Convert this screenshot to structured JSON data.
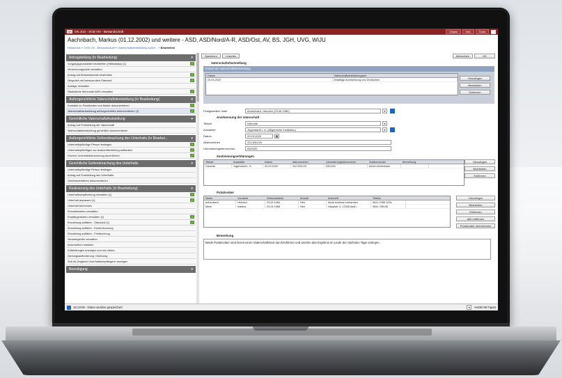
{
  "window": {
    "logo": "OK",
    "title": "OK.JUS - SGB VIII - Bestandschaft",
    "buttons": [
      "Objekt",
      "Info",
      "Tools"
    ]
  },
  "header": {
    "title": "Aachnbach, Markus (01.12.2002) und weitere - ASD, ASD/Nord/A-R, ASD/Ost, AV, BS, JGH, UVG, WIJU",
    "breadcrumb": [
      "Hellamaus",
      "SGB VIII - Bestandschaft",
      "Vaterschaftsfeststellung außer..."
    ],
    "breadcrumb_current": "Bearbeiten"
  },
  "left": {
    "sections": [
      {
        "title": "Antragstellung (In Bearbeitung)",
        "items": [
          {
            "label": "Vorgangsgrunddaten bearbeiten (Hilfeanlass) (1)",
            "check": true
          },
          {
            "label": "Verrechnungsziele verwalten",
            "check": false
          },
          {
            "label": "Antrag auf Beistandschaft bearbeiten",
            "check": true
          },
          {
            "label": "Gespräch mit betreuendem Elternteil",
            "check": true
          },
          {
            "label": "Anträge verwalten",
            "check": false
          },
          {
            "label": "Statistische Merkmale AiBS verwalten",
            "check": true
          }
        ]
      },
      {
        "title": "Außergerichtliche Vaterschaftsfeststellung (In Bearbeitung)",
        "items": [
          {
            "label": "Kontakte zu Putativvater und Mutter dokumentieren",
            "check": true
          },
          {
            "label": "Vaterschaftsfeststellung außergerichtlich dokumentieren (1)",
            "check": true,
            "selected": true
          }
        ]
      },
      {
        "title": "Gerichtliche Vaterschaftsfeststellung",
        "items": [
          {
            "label": "Antrag auf Feststellung der Vaterschaft",
            "check": false
          },
          {
            "label": "Vaterschaftsfeststellung gerichtlich dokumentieren",
            "check": false
          }
        ]
      },
      {
        "title": "Außergerichtliche Geltendmachung des Unterhalts (In Bearbei...",
        "items": [
          {
            "label": "Unterhaltspflichtige Person festlegen",
            "check": true
          },
          {
            "label": "Unterhaltspflichtigen zur Auskunftserteilung auffordern",
            "check": true
          },
          {
            "label": "Externe Unterhaltsberechnung durchführen",
            "check": true
          }
        ]
      },
      {
        "title": "Gerichtliche Geltendmachung des Unterhalts",
        "items": [
          {
            "label": "Unterhaltspflichtige Person festlegen",
            "check": false
          },
          {
            "label": "Antrag auf Feststellung des Unterhalts",
            "check": false
          },
          {
            "label": "Gerichtsverfahren dokumentieren",
            "check": false
          }
        ]
      },
      {
        "title": "Realisierung des Unterhalts (In Bearbeitung)",
        "items": [
          {
            "label": "Unterhaltsverpflichtung verwalten (1)",
            "check": true
          },
          {
            "label": "Unterhalt anpassen (1)",
            "check": true
          },
          {
            "label": "Unterhalt berechnen",
            "check": false
          },
          {
            "label": "Einzahlerdaten verwalten",
            "check": false
          },
          {
            "label": "Empfängerdaten verwalten (1)",
            "check": true
          },
          {
            "label": "Einzahlung auflisten - Standard (1)",
            "check": true
          },
          {
            "label": "Einzahlung auflisten - Kontenbuchung",
            "check": false
          },
          {
            "label": "Einzahlung auflisten - Fristbuchung",
            "check": false
          },
          {
            "label": "Verwahrgelder verwalten",
            "check": false
          },
          {
            "label": "Anschreiben erstellen",
            "check": false
          },
          {
            "label": "Sollstellungen anzeigen und neu bilden",
            "check": false
          },
          {
            "label": "Zahlungsaufforderung / Mahnung",
            "check": false
          },
          {
            "label": "Soll-Ist-Vergleich Unterhaltsempfängerin anzeigen",
            "check": false
          }
        ]
      },
      {
        "title": "Beendigung",
        "items": []
      }
    ]
  },
  "right": {
    "top_buttons": [
      "Speichern",
      "Löschen"
    ],
    "right_buttons": [
      "Abbrechen",
      "OK"
    ],
    "heading": "Vaterschaftsfeststellung",
    "subpanel_title": "Verlauf der Vaterschaftsfeststellung",
    "verlauf_cols": [
      "Datum",
      "Vaterschaftsfeststellungsart"
    ],
    "verlauf_rows": [
      [
        "20.03.2020",
        "freiwillige Anerkennung von Deutschen"
      ]
    ],
    "verlauf_buttons": [
      "Hinzufügen",
      "Bearbeiten",
      "Entfernen"
    ],
    "vater_label": "Festgestellter Vater",
    "vater_value": "Achenbach, Heinrich (23.06.1980)",
    "anerkennung_heading": "Anerkennung der Vaterschaft",
    "fields": [
      {
        "label": "Titelart",
        "value": "Urkunde"
      },
      {
        "label": "Aussteller",
        "value": "Jugendamt i. H. (Allgemeine Institution)"
      },
      {
        "label": "Datum",
        "value": "20.03.2020"
      },
      {
        "label": "Aktenzeichen",
        "value": "312.5/51/20"
      },
      {
        "label": "Urkundenregisternummer",
        "value": "53/2020"
      }
    ],
    "zustimmung_heading": "Zustimmungserklärungen",
    "zustimmung_cols": [
      "Titelart",
      "Aussteller",
      "Datum",
      "Aktenzeichen",
      "Urkundenregisternummer",
      "Zustimmender",
      "Bemerkung"
    ],
    "zustimmung_rows": [
      [
        "Urkunde",
        "Jugendamt i. H.",
        "20.03.2020",
        "312.5/51/20",
        "53/2020",
        "Achim Achenbach",
        ""
      ]
    ],
    "zustimmung_buttons": [
      "Hinzufügen",
      "Bearbeiten",
      "Entfernen"
    ],
    "putativ_heading": "Putativväter",
    "putativ_cols": [
      "Name",
      "Vorname",
      "Geburtsdatum",
      "Anrede",
      "Anschrift",
      "Telefon"
    ],
    "putativ_rows": [
      [
        "Achenbach",
        "Heinrich",
        "23.03.1984",
        "Herr",
        "keine Adresse vorhanden",
        "0641 2088 1234"
      ],
      [
        "Meier",
        "markus",
        "23.04.1986",
        "Herr",
        "Hauptstr. 5, 12345 Aach...",
        "0831 785136"
      ]
    ],
    "putativ_buttons": [
      "Hinzufügen",
      "Bearbeiten",
      "Entfernen",
      "Alle entfernen",
      "Putativvater übernehmen"
    ],
    "bemerkung_heading": "Bemerkung",
    "bemerkung_text": "Beide Putativväter sind bereit einen Vaterschaftstest durchzuführen und werden das Ergebnis im Laufe der nächsten Tage vorlegen."
  },
  "status": {
    "message": "16:13:09 - Daten wurden gespeichert",
    "right": "HeDB NETIgast"
  }
}
